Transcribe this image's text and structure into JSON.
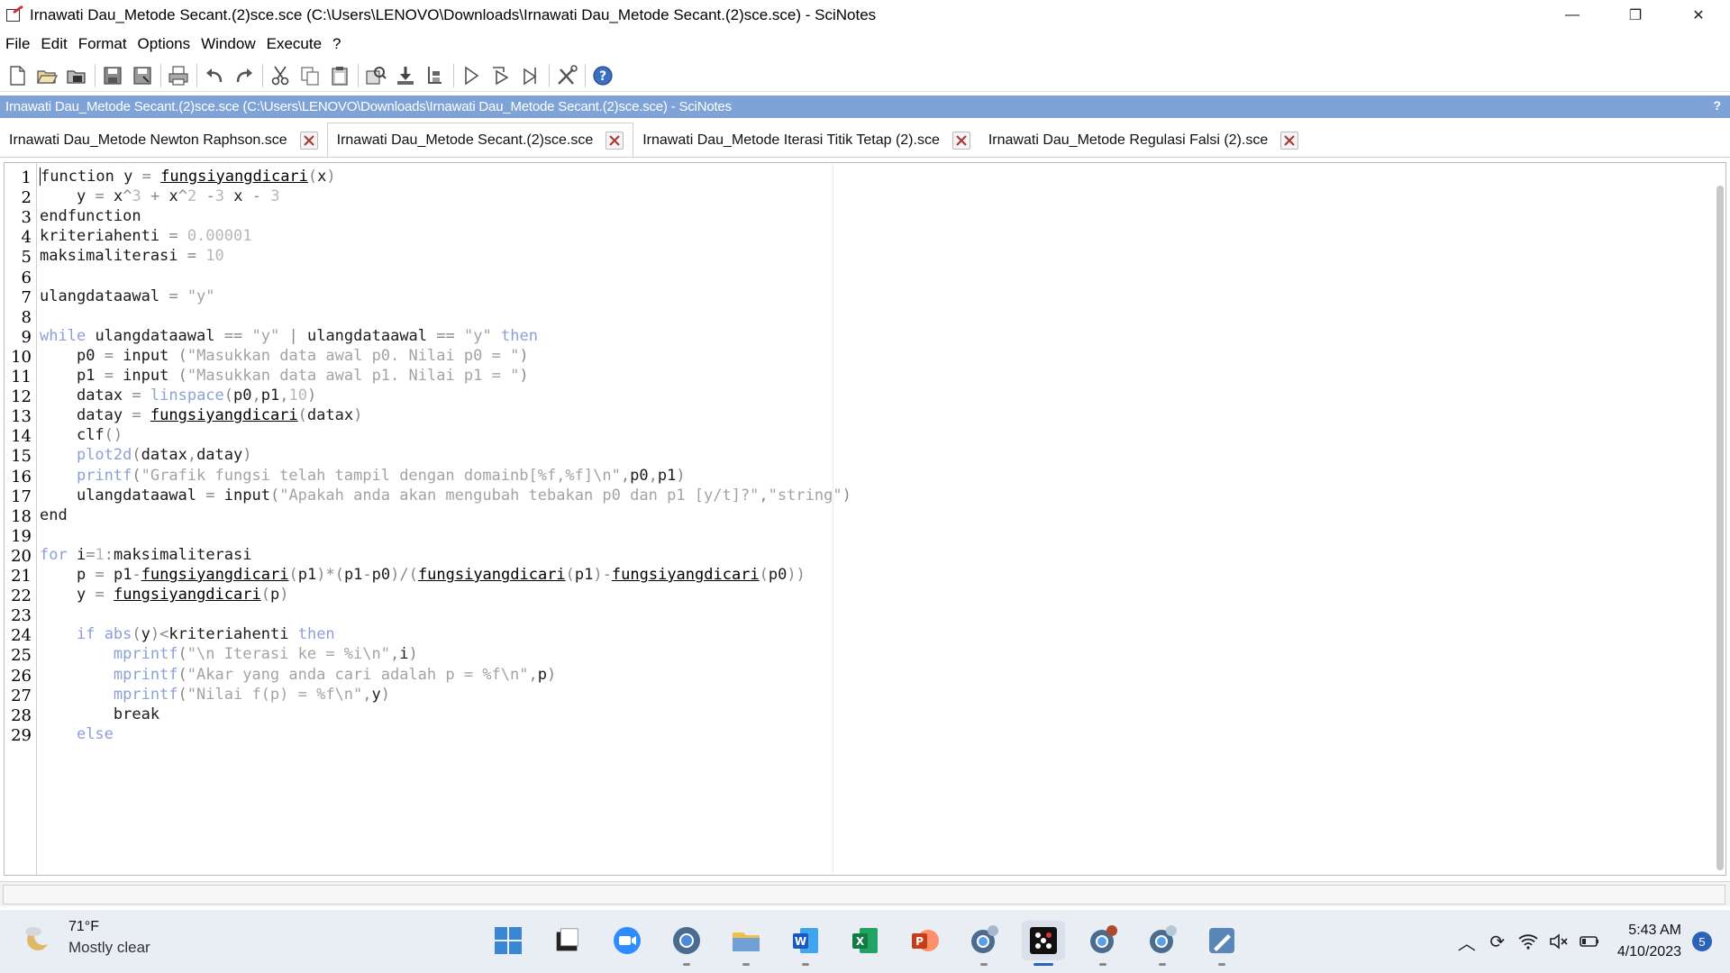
{
  "window": {
    "title": "Irnawati Dau_Metode Secant.(2)sce.sce (C:\\Users\\LENOVO\\Downloads\\Irnawati Dau_Metode Secant.(2)sce.sce) - SciNotes",
    "minimize_glyph": "—",
    "maximize_glyph": "❐",
    "close_glyph": "✕"
  },
  "menu": [
    "File",
    "Edit",
    "Format",
    "Options",
    "Window",
    "Execute",
    "?"
  ],
  "pathbar": {
    "text": "Irnawati Dau_Metode Secant.(2)sce.sce (C:\\Users\\LENOVO\\Downloads\\Irnawati Dau_Metode Secant.(2)sce.sce) - SciNotes",
    "help": "?"
  },
  "tabs": [
    {
      "label": "Irnawati Dau_Metode Newton Raphson.sce",
      "active": false
    },
    {
      "label": "Irnawati Dau_Metode Secant.(2)sce.sce",
      "active": true
    },
    {
      "label": "Irnawati Dau_Metode Iterasi Titik Tetap (2).sce",
      "active": false
    },
    {
      "label": "Irnawati Dau_Metode Regulasi Falsi (2).sce",
      "active": false
    }
  ],
  "line_numbers": [
    "1",
    "2",
    "3",
    "4",
    "5",
    "6",
    "7",
    "8",
    "9",
    "10",
    "11",
    "12",
    "13",
    "14",
    "15",
    "16",
    "17",
    "18",
    "19",
    "20",
    "21",
    "22",
    "23",
    "24",
    "25",
    "26",
    "27",
    "28",
    "29"
  ],
  "code_lines": [
    "function y = fungsiyangdicari(x)",
    "    y = x^3 + x^2 -3 x - 3",
    "endfunction",
    "kriteriahenti = 0.00001",
    "maksimaliterasi = 10",
    "",
    "ulangdataawal = \"y\"",
    "",
    "while ulangdataawal == \"y\" | ulangdataawal == \"y\" then",
    "    p0 = input (\"Masukkan data awal p0. Nilai p0 = \")",
    "    p1 = input (\"Masukkan data awal p1. Nilai p1 = \")",
    "    datax = linspace(p0,p1,10)",
    "    datay = fungsiyangdicari(datax)",
    "    clf()",
    "    plot2d(datax,datay)",
    "    printf(\"Grafik fungsi telah tampil dengan domainb[%f,%f]\\n\",p0,p1)",
    "    ulangdataawal = input(\"Apakah anda akan mengubah tebakan p0 dan p1 [y/t]?\",\"string\")",
    "end",
    "",
    "for i=1:maksimaliterasi",
    "    p = p1-fungsiyangdicari(p1)*(p1-p0)/(fungsiyangdicari(p1)-fungsiyangdicari(p0))",
    "    y = fungsiyangdicari(p)",
    "    ",
    "    if abs(y)<kriteriahenti then",
    "        mprintf(\"\\n Iterasi ke = %i\\n\",i)",
    "        mprintf(\"Akar yang anda cari adalah p = %f\\n\",p)",
    "        mprintf(\"Nilai f(p) = %f\\n\",y)",
    "        break",
    "    else"
  ],
  "taskbar": {
    "weather": {
      "temp": "71°F",
      "condition": "Mostly clear"
    },
    "apps": [
      "windows-start",
      "file-explorer-dark",
      "zoom",
      "chrome-like",
      "file-explorer",
      "word",
      "excel",
      "powerpoint",
      "chrome-profile-1",
      "scilab",
      "chrome-profile-2",
      "chrome-profile-3",
      "pen-app"
    ],
    "clock": {
      "time": "5:43 AM",
      "date": "4/10/2023"
    },
    "notification_count": "5"
  },
  "colors": {
    "pathbar_bg": "#7fa3d6",
    "keyword": "#8e9ed8",
    "string": "#a3a3a3",
    "number": "#b7b7b7"
  }
}
